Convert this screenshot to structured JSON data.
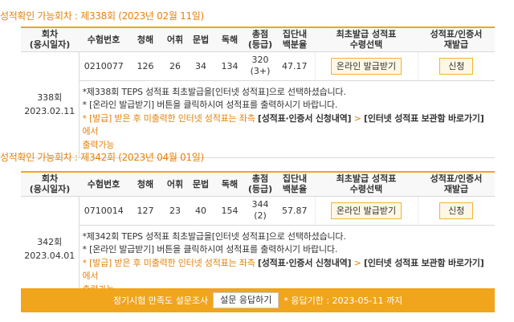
{
  "sections": [
    {
      "title": "성적확인 가능회차 : 제338회 (2023년 02월 11일)",
      "round": "338회",
      "date": "2023.02.11",
      "exam_number": "0210077",
      "listening": "126",
      "vocabulary": "26",
      "grammar": "34",
      "reading": "134",
      "total": "320",
      "total_sub": "(3+)",
      "percentile": "47.17",
      "issue_button": "온라인 발급받기",
      "apply_button": "신청",
      "notes": {
        "line1": "*제338회 TEPS 성적표 최초발급을[인터넷 성적표]으로 선택하셨습니다.",
        "line2": "* [온라인 발급받기] 버튼을 클릭하시여 성적표를 출력하시기 바랍니다.",
        "line3_prefix": "* [발급] 받은 후 미출력한 인터넷 성적표는 좌측",
        "line3_bold1": "[성적표·인증서 신청내역]",
        "line3_mid": " > ",
        "line3_bold2": "[인터넷 성적표 보관함 바로가기]",
        "line3_suffix": " 에서",
        "line4": "출력가능"
      }
    },
    {
      "title": "성적확인 가능회차 : 제342회 (2023년 04월 01일)",
      "round": "342회",
      "date": "2023.04.01",
      "exam_number": "0710014",
      "listening": "127",
      "vocabulary": "23",
      "grammar": "40",
      "reading": "154",
      "total": "344",
      "total_sub": "(2)",
      "percentile": "57.87",
      "issue_button": "온라인 발급받기",
      "apply_button": "신청",
      "notes": {
        "line1": "*제342회 TEPS 성적표 최초발급을[인터넷 성적표]으로 선택하셨습니다.",
        "line2": "* [온라인 발급받기] 버튼을 클릭하시여 성적표를 출력하시기 바랍니다.",
        "line3_prefix": "* [발급] 받은 후 미출력한 인터넷 성적표는 좌측",
        "line3_bold1": "[성적표·인증서 신청내역]",
        "line3_mid": " > ",
        "line3_bold2": "[인터넷 성적표 보관함 바로가기]",
        "line3_suffix": " 에서",
        "line4": "출력가능"
      }
    }
  ],
  "headers": {
    "round_line1": "회차",
    "round_line2": "(응시일자)",
    "exam_number": "수험번호",
    "listening": "청해",
    "vocabulary": "어휘",
    "grammar": "문법",
    "reading": "독해",
    "total_line1": "총점",
    "total_line2": "(등급)",
    "percentile_line1": "집단내",
    "percentile_line2": "백분율",
    "first_issue_line1": "최초발급 성적표",
    "first_issue_line2": "수령선택",
    "reissue_line1": "성적표/인증서",
    "reissue_line2": "재발급"
  },
  "footer": {
    "text": "정기시험 만족도 설문조사",
    "button": "설문 응답하기",
    "deadline": "* 응답기한 : 2023-05-11 까지"
  },
  "colors": {
    "accent": "#f0a51d",
    "title_orange": "#e3820e",
    "header_bg": "#f8f8f8",
    "button_bg": "#fef7e6"
  }
}
